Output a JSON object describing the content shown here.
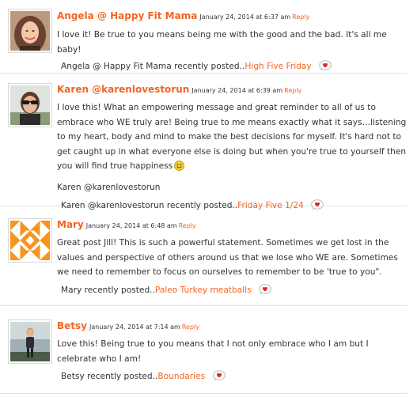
{
  "colors": {
    "accent": "#f26522",
    "text": "#333333",
    "divider": "#e3e3e3"
  },
  "comments": [
    {
      "author": "Angela @ Happy Fit Mama",
      "date": "January 24, 2014 at 6:37 am",
      "reply": "Reply",
      "paragraphs": [
        "I love it!  Be true to you means being me with the good and the bad. It's all me baby!"
      ],
      "recent_prefix": "Angela @ Happy Fit Mama recently posted..",
      "recent_link": "High Five Friday",
      "avatar": "woman-photo"
    },
    {
      "author": "Karen @karenlovestorun",
      "date": "January 24, 2014 at 6:39 am",
      "reply": "Reply",
      "paragraphs": [
        "I love this!  What an empowering message and great reminder to all of us to embrace who WE truly are!  Being true to me means exactly what it says…listening to my heart, body and mind to make the best decisions for myself. It's hard not to get caught up in what everyone else is doing but when you're true to yourself then you will find true happiness",
        "Karen @karenlovestorun"
      ],
      "recent_prefix": "Karen @karenlovestorun recently posted..",
      "recent_link": "Friday Five 1/24",
      "avatar": "sunglasses-photo"
    },
    {
      "author": "Mary",
      "date": "January 24, 2014 at 6:48 am",
      "reply": "Reply",
      "paragraphs": [
        "Great post Jill!  This is such a powerful statement. Sometimes we get lost in the values and perspective of others around us that we lose who WE are. Sometimes we need to remember to focus on ourselves to remember to be 'true to you\"."
      ],
      "recent_prefix": "Mary recently posted..",
      "recent_link": "Paleo Turkey meatballs",
      "avatar": "orange-identicon"
    },
    {
      "author": "Betsy",
      "date": "January 24, 2014 at 7:14 am",
      "reply": "Reply",
      "paragraphs": [
        "Love this!  Being true to you means that I not only embrace who I am but I celebrate who I am!"
      ],
      "recent_prefix": "Betsy recently posted..",
      "recent_link": "Boundaries",
      "avatar": "running-photo"
    }
  ]
}
